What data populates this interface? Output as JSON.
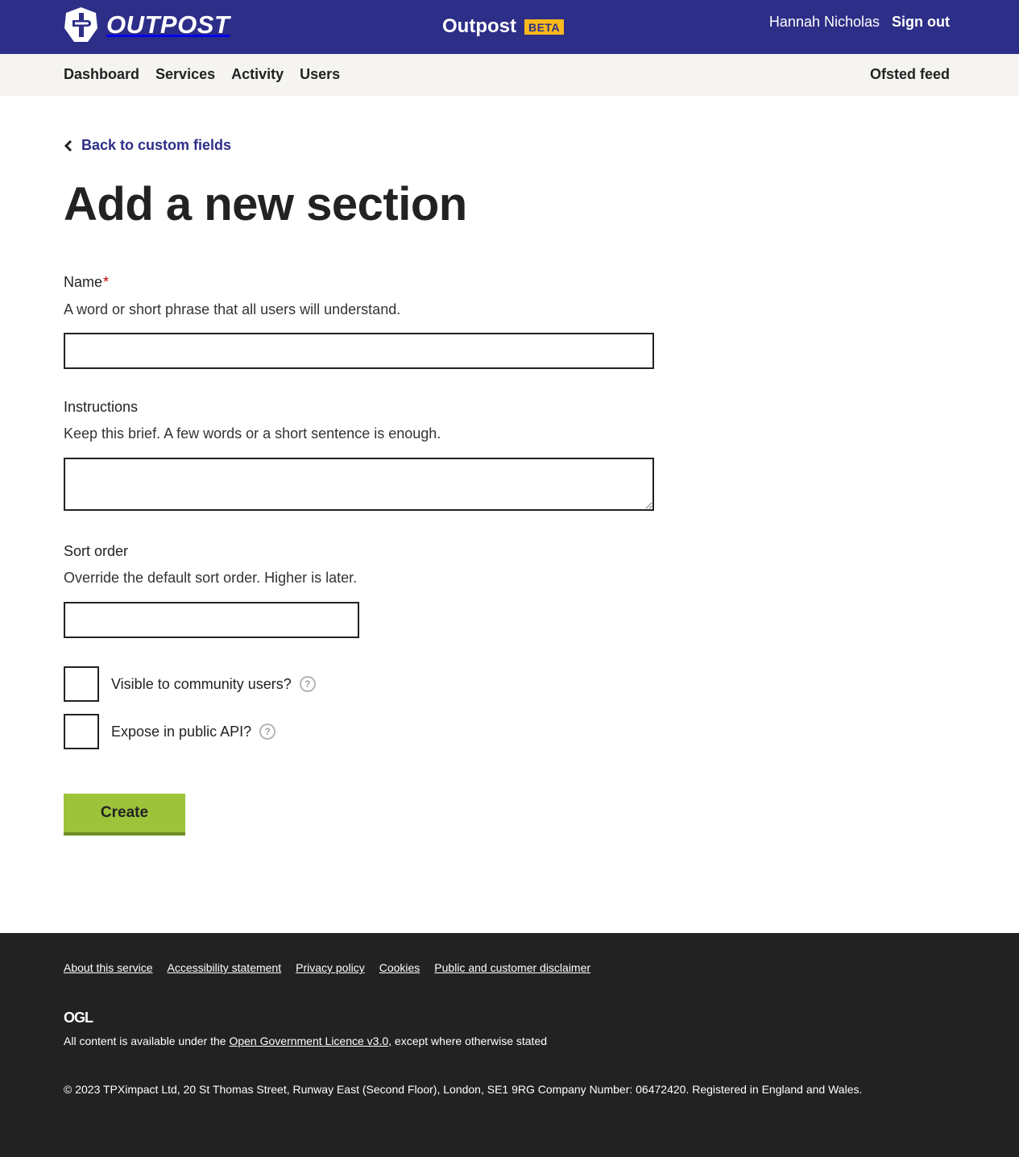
{
  "header": {
    "logo_text": "OUTPOST",
    "service_name": "Outpost",
    "beta_tag": "BETA",
    "user_name": "Hannah Nicholas",
    "sign_out": "Sign out",
    "brand_color": "#2d2e87",
    "beta_color": "#f7b91c"
  },
  "nav": {
    "items": [
      {
        "label": "Dashboard"
      },
      {
        "label": "Services"
      },
      {
        "label": "Activity"
      },
      {
        "label": "Users"
      }
    ],
    "right_link": "Ofsted feed"
  },
  "main": {
    "back_link": "Back to custom fields",
    "title": "Add a new section",
    "fields": {
      "name": {
        "label": "Name",
        "required_marker": "*",
        "hint": "A word or short phrase that all users will understand.",
        "value": ""
      },
      "instructions": {
        "label": "Instructions",
        "hint": "Keep this brief. A few words or a short sentence is enough.",
        "value": ""
      },
      "sort_order": {
        "label": "Sort order",
        "hint": "Override the default sort order. Higher is later.",
        "value": ""
      }
    },
    "checkboxes": [
      {
        "label": "Visible to community users?",
        "checked": false,
        "help": "?"
      },
      {
        "label": "Expose in public API?",
        "checked": false,
        "help": "?"
      }
    ],
    "submit_label": "Create",
    "button_color": "#9dc33b"
  },
  "footer": {
    "links": [
      {
        "label": "About this service"
      },
      {
        "label": "Accessibility statement"
      },
      {
        "label": "Privacy policy"
      },
      {
        "label": "Cookies"
      },
      {
        "label": "Public and customer disclaimer"
      }
    ],
    "ogl_logo": "OGL",
    "licence_prefix": "All content is available under the ",
    "licence_link": "Open Government Licence v3.0",
    "licence_suffix": ", except where otherwise stated",
    "copyright": "© 2023 TPXimpact Ltd, 20 St Thomas Street, Runway East (Second Floor), London, SE1 9RG Company Number: 06472420. Registered in England and Wales."
  }
}
